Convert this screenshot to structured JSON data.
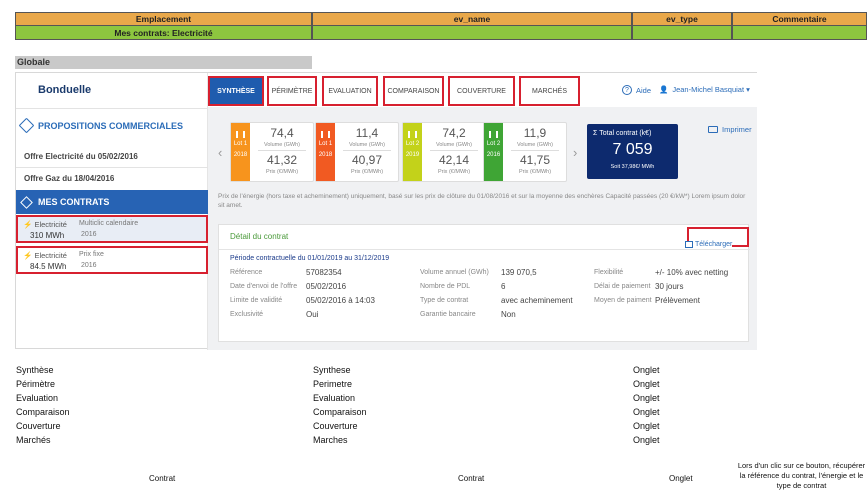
{
  "sheet": {
    "headers": [
      "Emplacement",
      "ev_name",
      "ev_type",
      "Commentaire"
    ],
    "row1": "Mes contrats: Electricité",
    "globale": "Globale"
  },
  "sidebar": {
    "brand": "Bonduelle",
    "propositions": "PROPOSITIONS COMMERCIALES",
    "offers": [
      "Offre Electricité du 05/02/2016",
      "Offre Gaz du 18/04/2016"
    ],
    "contracts_title": "MES CONTRATS",
    "contracts": [
      {
        "type": "Electricité",
        "volume": "310 MWh",
        "name": "Multiclic calendaire",
        "year": "2016"
      },
      {
        "type": "Electricité",
        "volume": "84.5 MWh",
        "name": "Prix fixe",
        "year": "2016"
      }
    ]
  },
  "tabs": [
    "SYNTHÈSE",
    "PÉRIMÈTRE",
    "EVALUATION",
    "COMPARAISON",
    "COUVERTURE",
    "MARCHÉS"
  ],
  "header": {
    "help": "Aide",
    "user": "Jean-Michel Basquiat ▾",
    "print": "Imprimer"
  },
  "lots": [
    {
      "lot": "Lot 1",
      "year": "2018",
      "volume": "74,4",
      "volume_unit": "Volume (GWh)",
      "price": "41,32",
      "price_unit": "Prix (€/MWh)",
      "color": "#f7941d"
    },
    {
      "lot": "Lot 1",
      "year": "2018",
      "volume": "11,4",
      "volume_unit": "Volume (GWh)",
      "price": "40,97",
      "price_unit": "Prix (€/MWh)",
      "color": "#f15a22"
    },
    {
      "lot": "Lot 2",
      "year": "2019",
      "volume": "74,2",
      "volume_unit": "Volume (GWh)",
      "price": "42,14",
      "price_unit": "Prix (€/MWh)",
      "color": "#c3d21a"
    },
    {
      "lot": "Lot 2",
      "year": "2016",
      "volume": "11,9",
      "volume_unit": "Volume (GWh)",
      "price": "41,75",
      "price_unit": "Prix (€/MWh)",
      "color": "#3fa535"
    }
  ],
  "total": {
    "title": "Σ Total contrat (k€)",
    "value": "7 059",
    "sub": "Soit 37,98€/ MWh"
  },
  "disclaimer": "Prix de l'énergie (hors taxe et acheminement) uniquement, basé sur les prix de clôture du 01/08/2016 et sur la moyenne des enchères Capacité passées (20 €/kW*) Lorem ipsum dolor sit amet.",
  "detail": {
    "title": "Détail du contrat",
    "download": "Télécharger",
    "period": "Période contractuelle du 01/01/2019 au 31/12/2019",
    "col1": [
      {
        "k": "Référence",
        "v": "57082354"
      },
      {
        "k": "Date d'envoi de l'offre",
        "v": "05/02/2016"
      },
      {
        "k": "Limite de validité",
        "v": "05/02/2016 à 14:03"
      },
      {
        "k": "Exclusivité",
        "v": "Oui"
      }
    ],
    "col2": [
      {
        "k": "Volume annuel (GWh)",
        "v": "139 070,5"
      },
      {
        "k": "Nombre de PDL",
        "v": "6"
      },
      {
        "k": "Type de contrat",
        "v": "avec acheminement"
      },
      {
        "k": "Garantie bancaire",
        "v": "Non"
      }
    ],
    "col3": [
      {
        "k": "Flexibilité",
        "v": "+/- 10% avec netting"
      },
      {
        "k": "Délai de paiement",
        "v": "30 jours"
      },
      {
        "k": "Moyen de paiment",
        "v": "Prélèvement"
      }
    ]
  },
  "rows": [
    {
      "a": "Synthèse",
      "b": "Synthese",
      "c": "Onglet"
    },
    {
      "a": "Périmètre",
      "b": "Perimetre",
      "c": "Onglet"
    },
    {
      "a": "Evaluation",
      "b": "Evaluation",
      "c": "Onglet"
    },
    {
      "a": "Comparaison",
      "b": "Comparaison",
      "c": "Onglet"
    },
    {
      "a": "Couverture",
      "b": "Couverture",
      "c": "Onglet"
    },
    {
      "a": "Marchés",
      "b": "Marches",
      "c": "Onglet"
    }
  ],
  "contrat_row": {
    "a": "Contrat",
    "b": "Contrat",
    "c": "Onglet",
    "d": "Lors d'un clic sur ce bouton, récupérer la référence du contrat, l'énergie et le type de contrat"
  }
}
